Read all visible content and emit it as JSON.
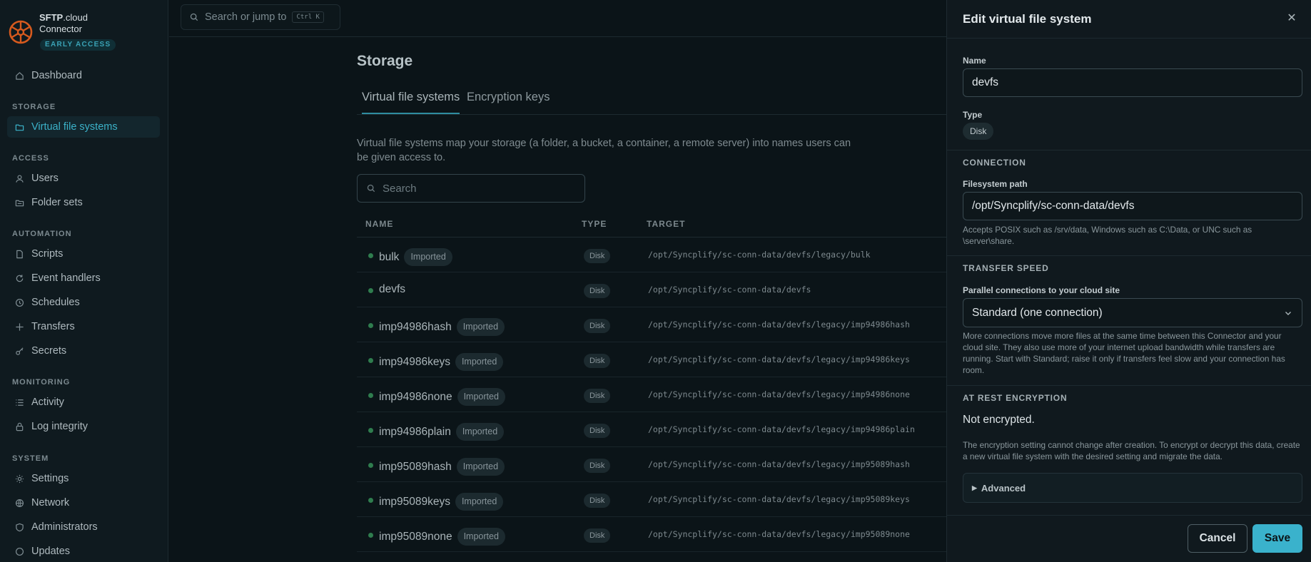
{
  "brand": {
    "name_bold": "SFTP",
    "name_rest": ".cloud",
    "subtitle": "Connector",
    "badge": "EARLY ACCESS"
  },
  "sidebar": {
    "dashboard": "Dashboard",
    "sections": {
      "storage": "STORAGE",
      "access": "ACCESS",
      "automation": "AUTOMATION",
      "monitoring": "MONITORING",
      "system": "SYSTEM"
    },
    "items": {
      "virtual_file_systems": "Virtual file systems",
      "users": "Users",
      "folder_sets": "Folder sets",
      "scripts": "Scripts",
      "event_handlers": "Event handlers",
      "schedules": "Schedules",
      "transfers": "Transfers",
      "secrets": "Secrets",
      "activity": "Activity",
      "log_integrity": "Log integrity",
      "settings": "Settings",
      "network": "Network",
      "administrators": "Administrators",
      "updates": "Updates"
    }
  },
  "topbar": {
    "search_label": "Search or jump to",
    "shortcut": "Ctrl K"
  },
  "main": {
    "title": "Storage",
    "tabs": [
      "Virtual file systems",
      "Encryption keys"
    ],
    "description": "Virtual file systems map your storage (a folder, a bucket, a container, a remote server) into names users can be given access to.",
    "search_placeholder": "Search",
    "columns": {
      "name": "NAME",
      "type": "TYPE",
      "target": "TARGET"
    },
    "imported_label": "Imported",
    "rows": [
      {
        "name": "bulk",
        "imported": true,
        "type": "Disk",
        "target": "/opt/Syncplify/sc-conn-data/devfs/legacy/bulk"
      },
      {
        "name": "devfs",
        "imported": false,
        "type": "Disk",
        "target": "/opt/Syncplify/sc-conn-data/devfs"
      },
      {
        "name": "imp94986hash",
        "imported": true,
        "type": "Disk",
        "target": "/opt/Syncplify/sc-conn-data/devfs/legacy/imp94986hash"
      },
      {
        "name": "imp94986keys",
        "imported": true,
        "type": "Disk",
        "target": "/opt/Syncplify/sc-conn-data/devfs/legacy/imp94986keys"
      },
      {
        "name": "imp94986none",
        "imported": true,
        "type": "Disk",
        "target": "/opt/Syncplify/sc-conn-data/devfs/legacy/imp94986none"
      },
      {
        "name": "imp94986plain",
        "imported": true,
        "type": "Disk",
        "target": "/opt/Syncplify/sc-conn-data/devfs/legacy/imp94986plain"
      },
      {
        "name": "imp95089hash",
        "imported": true,
        "type": "Disk",
        "target": "/opt/Syncplify/sc-conn-data/devfs/legacy/imp95089hash"
      },
      {
        "name": "imp95089keys",
        "imported": true,
        "type": "Disk",
        "target": "/opt/Syncplify/sc-conn-data/devfs/legacy/imp95089keys"
      },
      {
        "name": "imp95089none",
        "imported": true,
        "type": "Disk",
        "target": "/opt/Syncplify/sc-conn-data/devfs/legacy/imp95089none"
      }
    ]
  },
  "drawer": {
    "title": "Edit virtual file system",
    "name_label": "Name",
    "name_value": "devfs",
    "type_label": "Type",
    "type_value": "Disk",
    "connection_heading": "CONNECTION",
    "path_label": "Filesystem path",
    "path_value": "/opt/Syncplify/sc-conn-data/devfs",
    "path_help": "Accepts POSIX such as /srv/data, Windows such as C:\\Data, or UNC such as \\server\\share.",
    "transfer_heading": "TRANSFER SPEED",
    "parallel_label": "Parallel connections to your cloud site",
    "parallel_value": "Standard (one connection)",
    "parallel_help": "More connections move more files at the same time between this Connector and your cloud site. They also use more of your internet upload bandwidth while transfers are running. Start with Standard; raise it only if transfers feel slow and your connection has room.",
    "encryption_heading": "AT REST ENCRYPTION",
    "encryption_status": "Not encrypted.",
    "encryption_help": "The encryption setting cannot change after creation. To encrypt or decrypt this data, create a new virtual file system with the desired setting and migrate the data.",
    "advanced_label": "Advanced",
    "cancel_label": "Cancel",
    "save_label": "Save"
  },
  "colors": {
    "accent": "#3ab2cc",
    "active_nav": "#3bb2c9",
    "status_dot": "#2f7d4e",
    "brand_logo": "#d65a1e"
  }
}
